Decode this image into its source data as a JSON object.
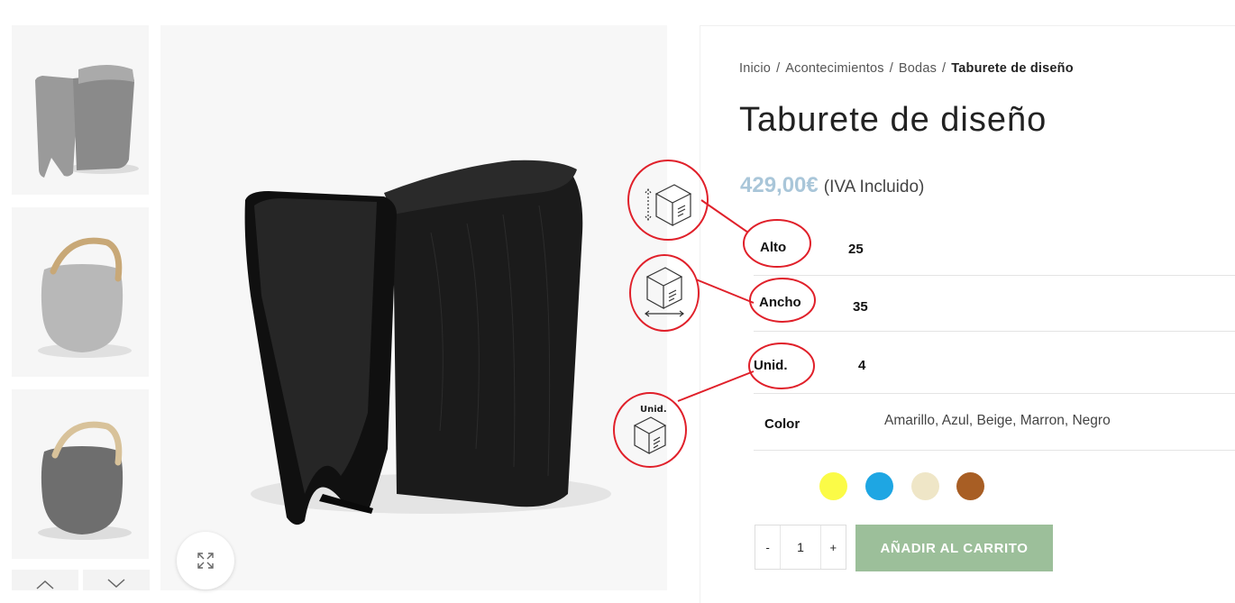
{
  "breadcrumb": {
    "items": [
      "Inicio",
      "Acontecimientos",
      "Bodas"
    ],
    "separator": "/",
    "current": "Taburete de diseño"
  },
  "product": {
    "title": "Taburete de diseño",
    "price": "429,00€",
    "tax_note": "(IVA Incluido)"
  },
  "attributes": [
    {
      "label": "Alto",
      "value": "25"
    },
    {
      "label": "Ancho",
      "value": "35"
    },
    {
      "label": "Unid.",
      "value": "4"
    },
    {
      "label": "Color",
      "value": "Amarillo, Azul, Beige, Marron, Negro"
    }
  ],
  "annotation_icons": {
    "unid_box_label": "Unid."
  },
  "swatches": [
    {
      "name": "Amarillo",
      "color": "#fbfb47"
    },
    {
      "name": "Azul",
      "color": "#1ea6e3"
    },
    {
      "name": "Beige",
      "color": "#efe6c7"
    },
    {
      "name": "Marron",
      "color": "#a85e24"
    }
  ],
  "cart": {
    "minus": "-",
    "quantity": "1",
    "plus": "+",
    "add_label": "AÑADIR AL CARRITO"
  },
  "colors": {
    "accent_price": "#a9c6d9",
    "button_bg": "#9cbf9a",
    "annotation_red": "#e0202a"
  },
  "icons": {
    "zoom": "expand-icon",
    "thumb_prev": "chevron-up-icon",
    "thumb_next": "chevron-down-icon",
    "height_box": "box-height-icon",
    "width_box": "box-width-icon",
    "units_box": "box-units-icon"
  }
}
